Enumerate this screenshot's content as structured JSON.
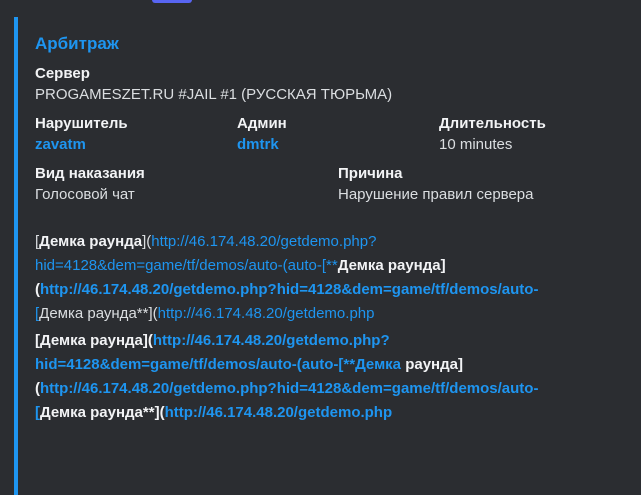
{
  "embed": {
    "accent_color": "#1e95f0",
    "title": "Арбитраж",
    "server": {
      "label": "Сервер",
      "value": "PROGAMESZET.RU #JAIL #1 (РУССКАЯ ТЮРЬМА)"
    },
    "violator": {
      "label": "Нарушитель",
      "value": "zavatm"
    },
    "admin": {
      "label": "Админ",
      "value": "dmtrk"
    },
    "duration": {
      "label": "Длительность",
      "value": "10 minutes"
    },
    "punishment": {
      "label": "Вид наказания",
      "value": "Голосовой чат"
    },
    "reason": {
      "label": "Причина",
      "value": "Нарушение правил сервера"
    },
    "description": {
      "p1": {
        "s1": "[",
        "s2": "Демка раунда",
        "s3": "](",
        "link1a": "http://46.174.48.20/getdemo.php?",
        "link1b": "hid=4128&dem=game/tf/demos/auto-(auto-[**",
        "s4": "Демка",
        "s5": " раунда]",
        "s6": "(",
        "link2": "http://46.174.48.20/getdemo.php?hid=4128&dem=game/tf/demos/auto-",
        "s7": "[",
        "s8": "Демка раунда**](",
        "link3": "http://46.174.48.20/getdemo.php"
      },
      "p2": {
        "s1": "[Демка раунда](",
        "link1a": "http://46.174.48.20/getdemo.php?",
        "link1b": "hid=4128&dem=game/tf/demos/auto-(auto-[**",
        "s4": "Демка",
        "s5": " раунда]",
        "s6": "(",
        "link2": "http://46.174.48.20/getdemo.php?hid=4128&dem=game/tf/demos/auto-",
        "s7": "[",
        "s8": "Демка раунда**](",
        "link3": "http://46.174.48.20/getdemo.php"
      }
    }
  }
}
